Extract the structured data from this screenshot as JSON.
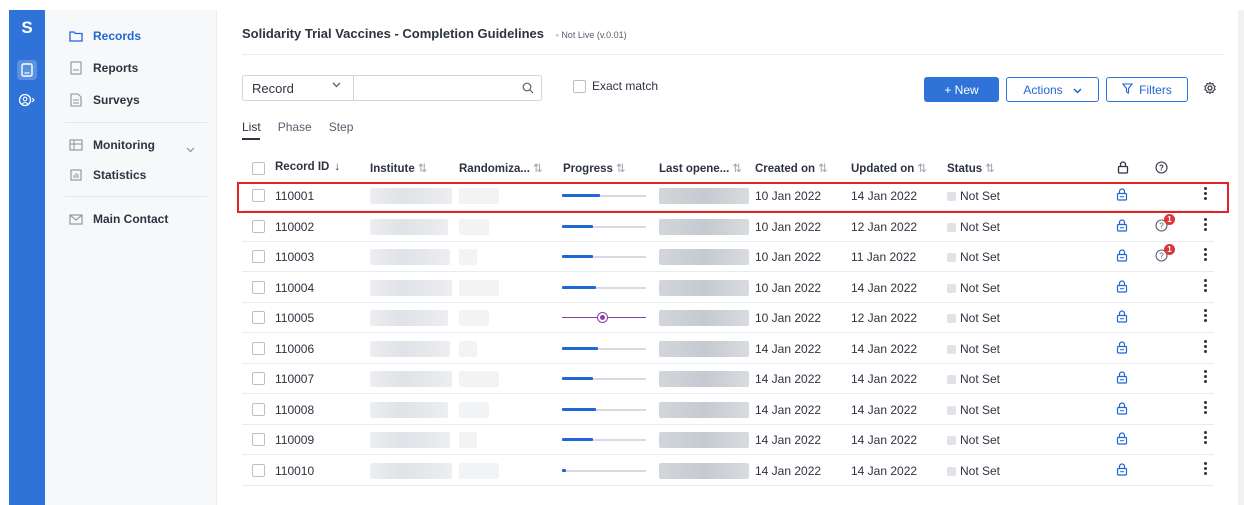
{
  "rail": {
    "logo": "S",
    "icons": [
      "records-rail-icon",
      "user-rail-icon"
    ]
  },
  "sidebar": {
    "items": [
      {
        "label": "Records",
        "icon": "folder-icon",
        "active": true
      },
      {
        "label": "Reports",
        "icon": "report-icon"
      },
      {
        "label": "Surveys",
        "icon": "survey-icon"
      },
      {
        "label": "Monitoring",
        "icon": "monitoring-icon"
      },
      {
        "label": "Statistics",
        "icon": "statistics-icon"
      },
      {
        "label": "Main Contact",
        "icon": "mail-icon"
      }
    ]
  },
  "header": {
    "title": "Solidarity Trial Vaccines - Completion Guidelines",
    "badge": "Not Live (v.0.01)"
  },
  "search": {
    "select_value": "Record",
    "placeholder": ""
  },
  "toolbar": {
    "exact_match": "Exact match",
    "new": "+ New",
    "actions": "Actions",
    "filters": "Filters"
  },
  "tabs": [
    "List",
    "Phase",
    "Step"
  ],
  "table": {
    "headers": {
      "record_id": "Record ID",
      "institute": "Institute",
      "randomization": "Randomiza...",
      "progress": "Progress",
      "last_opened": "Last opene...",
      "created_on": "Created on",
      "updated_on": "Updated on",
      "status": "Status"
    },
    "rows": [
      {
        "id": "110001",
        "created": "10 Jan 2022",
        "updated": "14 Jan 2022",
        "status": "Not Set",
        "progress": 0.45,
        "queries": ""
      },
      {
        "id": "110002",
        "created": "10 Jan 2022",
        "updated": "12 Jan 2022",
        "status": "Not Set",
        "progress": 0.37,
        "queries": "1"
      },
      {
        "id": "110003",
        "created": "10 Jan 2022",
        "updated": "11 Jan 2022",
        "status": "Not Set",
        "progress": 0.37,
        "queries": "1"
      },
      {
        "id": "110004",
        "created": "10 Jan 2022",
        "updated": "14 Jan 2022",
        "status": "Not Set",
        "progress": 0.4,
        "queries": ""
      },
      {
        "id": "110005",
        "created": "10 Jan 2022",
        "updated": "12 Jan 2022",
        "status": "Not Set",
        "progress": 0.45,
        "queries": ""
      },
      {
        "id": "110006",
        "created": "14 Jan 2022",
        "updated": "14 Jan 2022",
        "status": "Not Set",
        "progress": 0.43,
        "queries": ""
      },
      {
        "id": "110007",
        "created": "14 Jan 2022",
        "updated": "14 Jan 2022",
        "status": "Not Set",
        "progress": 0.37,
        "queries": ""
      },
      {
        "id": "110008",
        "created": "14 Jan 2022",
        "updated": "14 Jan 2022",
        "status": "Not Set",
        "progress": 0.4,
        "queries": ""
      },
      {
        "id": "110009",
        "created": "14 Jan 2022",
        "updated": "14 Jan 2022",
        "status": "Not Set",
        "progress": 0.37,
        "queries": ""
      },
      {
        "id": "110010",
        "created": "14 Jan 2022",
        "updated": "14 Jan 2022",
        "status": "Not Set",
        "progress": 0.05,
        "queries": ""
      }
    ]
  },
  "colors": {
    "accent": "#2f73d9",
    "highlight": "#e02424",
    "progress": "#1f66d6",
    "progress_alt": "#8e3ba8",
    "query_badge": "#d93636"
  }
}
